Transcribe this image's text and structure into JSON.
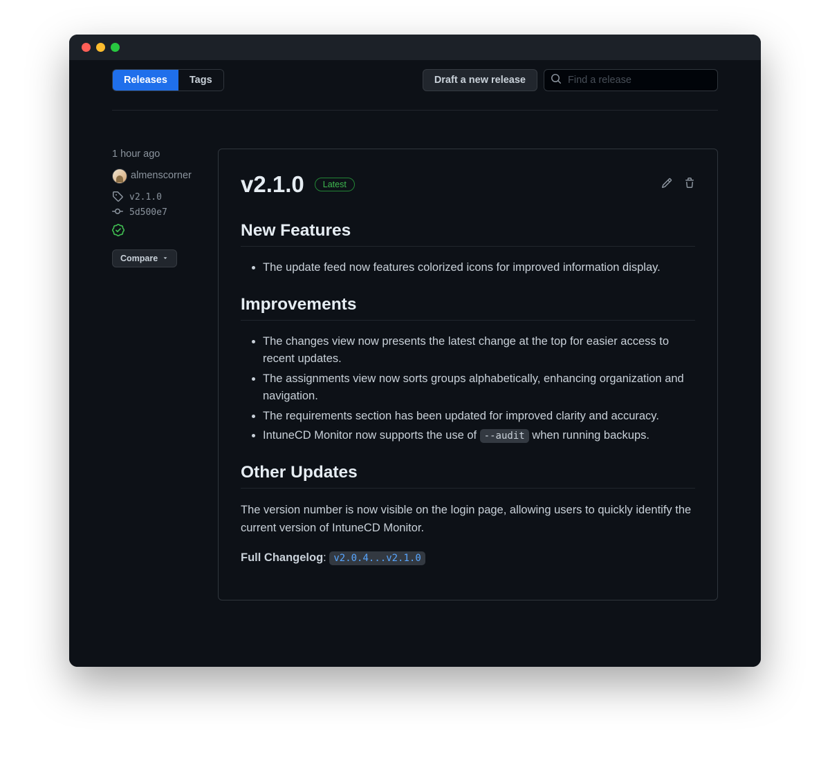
{
  "tabs": {
    "releases": "Releases",
    "tags": "Tags"
  },
  "header": {
    "draft_button": "Draft a new release",
    "search_placeholder": "Find a release"
  },
  "sidebar": {
    "time": "1 hour ago",
    "author": "almenscorner",
    "tag": "v2.1.0",
    "commit": "5d500e7",
    "compare": "Compare"
  },
  "release": {
    "version": "v2.1.0",
    "badge": "Latest",
    "sections": {
      "new_features": {
        "title": "New Features",
        "items": [
          "The update feed now features colorized icons for improved information display."
        ]
      },
      "improvements": {
        "title": "Improvements",
        "items": [
          "The changes view now presents the latest change at the top for easier access to recent updates.",
          "The assignments view now sorts groups alphabetically, enhancing organization and navigation.",
          "The requirements section has been updated for improved clarity and accuracy."
        ],
        "item_code_pre": "IntuneCD Monitor now supports the use of ",
        "item_code": "--audit",
        "item_code_post": " when running backups."
      },
      "other": {
        "title": "Other Updates",
        "text": "The version number is now visible on the login page, allowing users to quickly identify the current version of IntuneCD Monitor."
      }
    },
    "changelog_label": "Full Changelog",
    "changelog_link": "v2.0.4...v2.1.0"
  }
}
